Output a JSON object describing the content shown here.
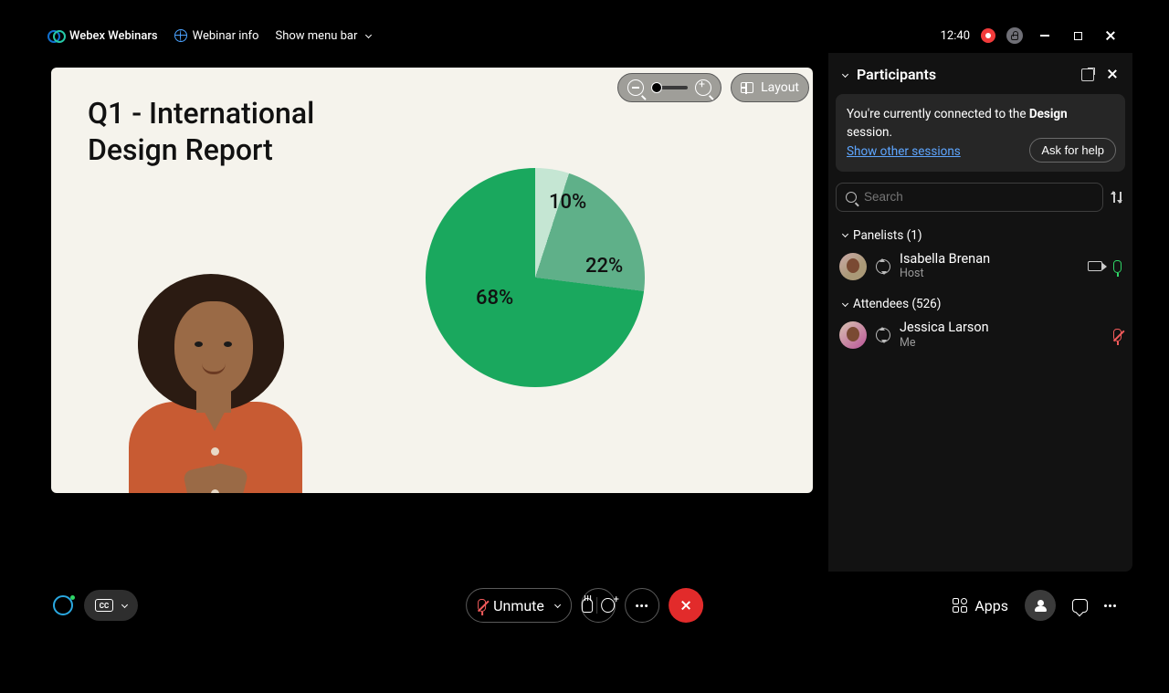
{
  "titlebar": {
    "app_name": "Webex Webinars",
    "webinar_info": "Webinar info",
    "show_menu": "Show menu bar",
    "clock": "12:40"
  },
  "stage": {
    "layout_label": "Layout",
    "slide_title_line1": "Q1 -  International",
    "slide_title_line2": "Design Report"
  },
  "chart_data": {
    "type": "pie",
    "slices": [
      {
        "label": "10%",
        "value": 10,
        "color": "#c5e6d3"
      },
      {
        "label": "22%",
        "value": 22,
        "color": "#5fb089"
      },
      {
        "label": "68%",
        "value": 68,
        "color": "#1aa85e"
      }
    ]
  },
  "panel": {
    "title": "Participants",
    "notice_prefix": "You're currently connected to the ",
    "notice_session": "Design",
    "notice_suffix": " session.",
    "show_other": "Show other sessions",
    "ask_help": "Ask for help",
    "search_placeholder": "Search",
    "groups": {
      "panelists": {
        "label": "Panelists (1)"
      },
      "attendees": {
        "label": "Attendees (526)"
      }
    },
    "panelist": {
      "name": "Isabella Brenan",
      "role": "Host"
    },
    "attendee": {
      "name": "Jessica Larson",
      "role": "Me"
    }
  },
  "bottom": {
    "cc": "CC",
    "unmute": "Unmute",
    "apps": "Apps"
  }
}
